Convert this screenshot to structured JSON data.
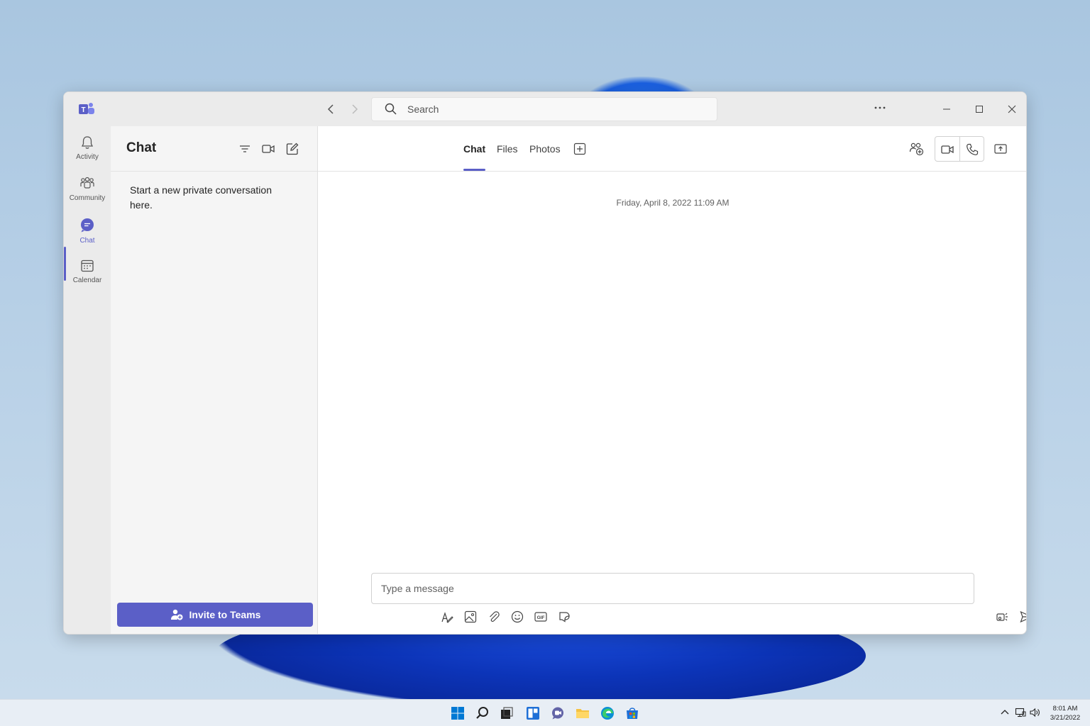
{
  "search": {
    "placeholder": "Search"
  },
  "rail": {
    "items": [
      {
        "label": "Activity"
      },
      {
        "label": "Community"
      },
      {
        "label": "Chat"
      },
      {
        "label": "Calendar"
      }
    ]
  },
  "chatlist": {
    "title": "Chat",
    "empty_message": "Start a new private conversation here.",
    "invite_label": "Invite to Teams"
  },
  "main": {
    "tabs": [
      {
        "label": "Chat",
        "active": true
      },
      {
        "label": "Files"
      },
      {
        "label": "Photos"
      }
    ],
    "timestamp": "Friday, April 8, 2022 11:09 AM"
  },
  "composer": {
    "placeholder": "Type a message"
  },
  "taskbar": {
    "time": "8:01 AM",
    "date": "3/21/2022"
  },
  "colors": {
    "accent": "#5b5fc7",
    "titlebar": "#ebebeb",
    "sidebar": "#f5f5f5"
  }
}
